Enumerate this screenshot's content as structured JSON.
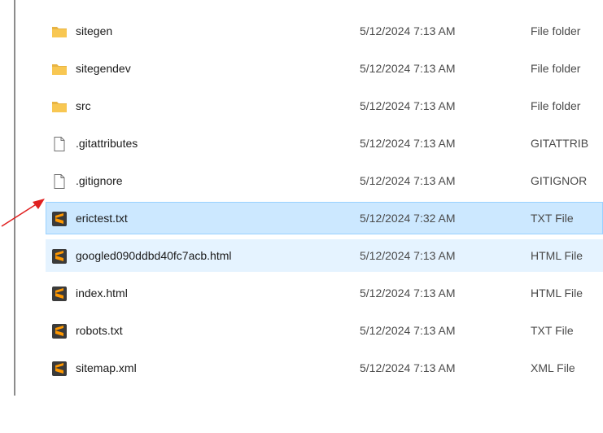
{
  "files": [
    {
      "name": "sitegen",
      "date": "5/12/2024 7:13 AM",
      "type": "File folder",
      "icon": "folder-icon"
    },
    {
      "name": "sitegendev",
      "date": "5/12/2024 7:13 AM",
      "type": "File folder",
      "icon": "folder-icon"
    },
    {
      "name": "src",
      "date": "5/12/2024 7:13 AM",
      "type": "File folder",
      "icon": "folder-icon"
    },
    {
      "name": ".gitattributes",
      "date": "5/12/2024 7:13 AM",
      "type": "GITATTRIB",
      "icon": "file-icon"
    },
    {
      "name": ".gitignore",
      "date": "5/12/2024 7:13 AM",
      "type": "GITIGNOR",
      "icon": "file-icon"
    },
    {
      "name": "erictest.txt",
      "date": "5/12/2024 7:32 AM",
      "type": "TXT File",
      "icon": "sublime-text-icon"
    },
    {
      "name": "googled090ddbd40fc7acb.html",
      "date": "5/12/2024 7:13 AM",
      "type": "HTML File",
      "icon": "sublime-text-icon"
    },
    {
      "name": "index.html",
      "date": "5/12/2024 7:13 AM",
      "type": "HTML File",
      "icon": "sublime-text-icon"
    },
    {
      "name": "robots.txt",
      "date": "5/12/2024 7:13 AM",
      "type": "TXT File",
      "icon": "sublime-text-icon"
    },
    {
      "name": "sitemap.xml",
      "date": "5/12/2024 7:13 AM",
      "type": "XML File",
      "icon": "sublime-text-icon"
    }
  ],
  "colors": {
    "selected_bg": "#cce8ff",
    "selected_border": "#99d1ff",
    "hover_bg": "#e5f3ff",
    "folder_yellow": "#f8c752",
    "sublime_orange": "#ff9800",
    "annotation_red": "#e02020"
  }
}
